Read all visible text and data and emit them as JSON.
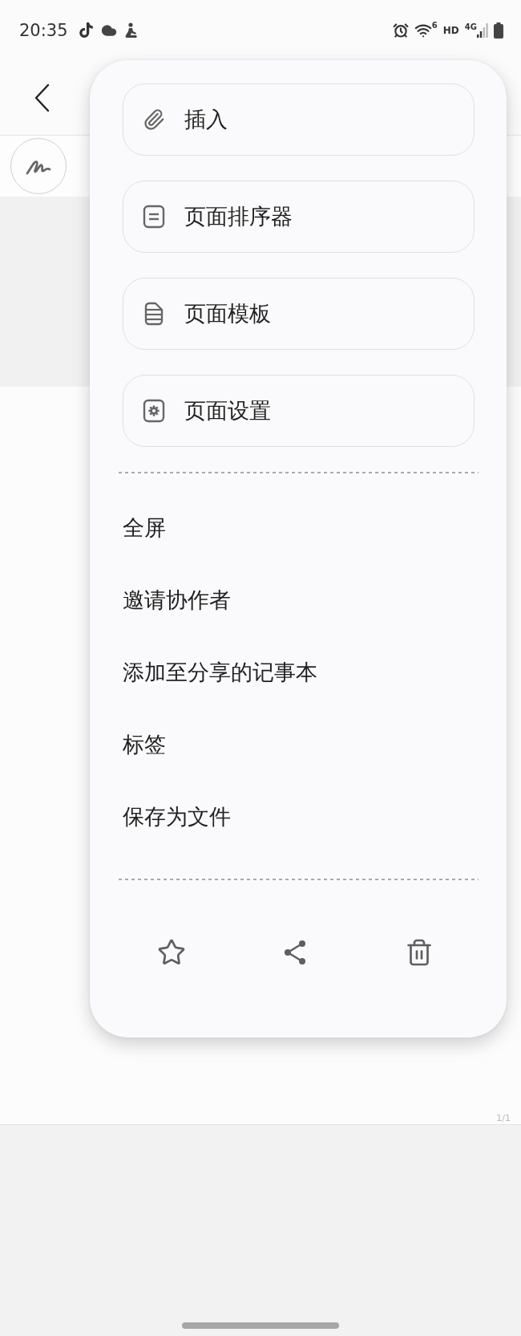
{
  "status_bar": {
    "time": "20:35",
    "wifi_label": "6",
    "hd_label": "HD",
    "network_label": "4G"
  },
  "menu": {
    "options": [
      {
        "label": "插入"
      },
      {
        "label": "页面排序器"
      },
      {
        "label": "页面模板"
      },
      {
        "label": "页面设置"
      }
    ],
    "items": [
      {
        "label": "全屏"
      },
      {
        "label": "邀请协作者"
      },
      {
        "label": "添加至分享的记事本"
      },
      {
        "label": "标签"
      },
      {
        "label": "保存为文件"
      }
    ]
  },
  "page": {
    "page_indicator": "1/1"
  }
}
